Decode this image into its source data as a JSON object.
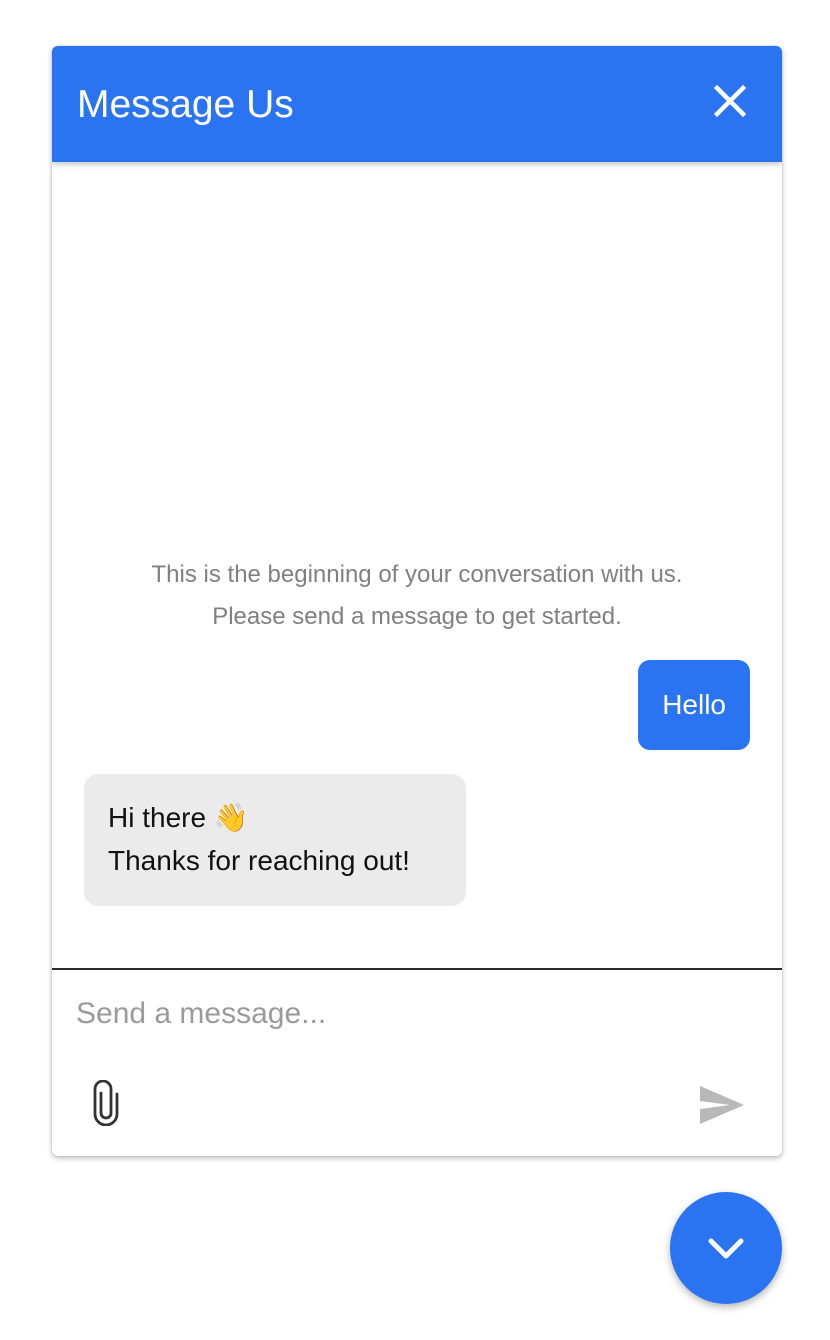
{
  "header": {
    "title": "Message Us",
    "close_icon": "close-icon"
  },
  "conversation": {
    "intro_line1": "This is the beginning of your conversation with us.",
    "intro_line2": "Please send a message to get started.",
    "messages": [
      {
        "sender": "user",
        "text": "Hello"
      },
      {
        "sender": "agent",
        "line1": "Hi there 👋",
        "line2": "Thanks for reaching out!"
      }
    ]
  },
  "composer": {
    "placeholder": "Send a message...",
    "value": "",
    "attach_icon": "paperclip-icon",
    "send_icon": "send-icon"
  },
  "launcher": {
    "icon": "chevron-down-icon"
  },
  "colors": {
    "accent": "#2a74f1",
    "incoming_bubble": "#ebebeb",
    "muted_text": "#808080"
  }
}
